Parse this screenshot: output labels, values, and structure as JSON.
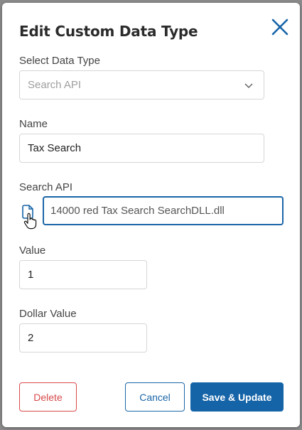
{
  "dialog": {
    "title": "Edit Custom Data Type",
    "close_icon": "close-icon"
  },
  "form": {
    "data_type": {
      "label": "Select Data Type",
      "value": "Search API",
      "disabled": true
    },
    "name": {
      "label": "Name",
      "value": "Tax Search"
    },
    "search_api": {
      "label": "Search API",
      "value": "14000 red Tax Search SearchDLL.dll",
      "icon": "file-icon"
    },
    "value": {
      "label": "Value",
      "value": "1"
    },
    "dollar_value": {
      "label": "Dollar Value",
      "value": "2"
    }
  },
  "buttons": {
    "delete": "Delete",
    "cancel": "Cancel",
    "save": "Save & Update"
  },
  "colors": {
    "primary": "#1564a8",
    "danger": "#d84a4a"
  }
}
